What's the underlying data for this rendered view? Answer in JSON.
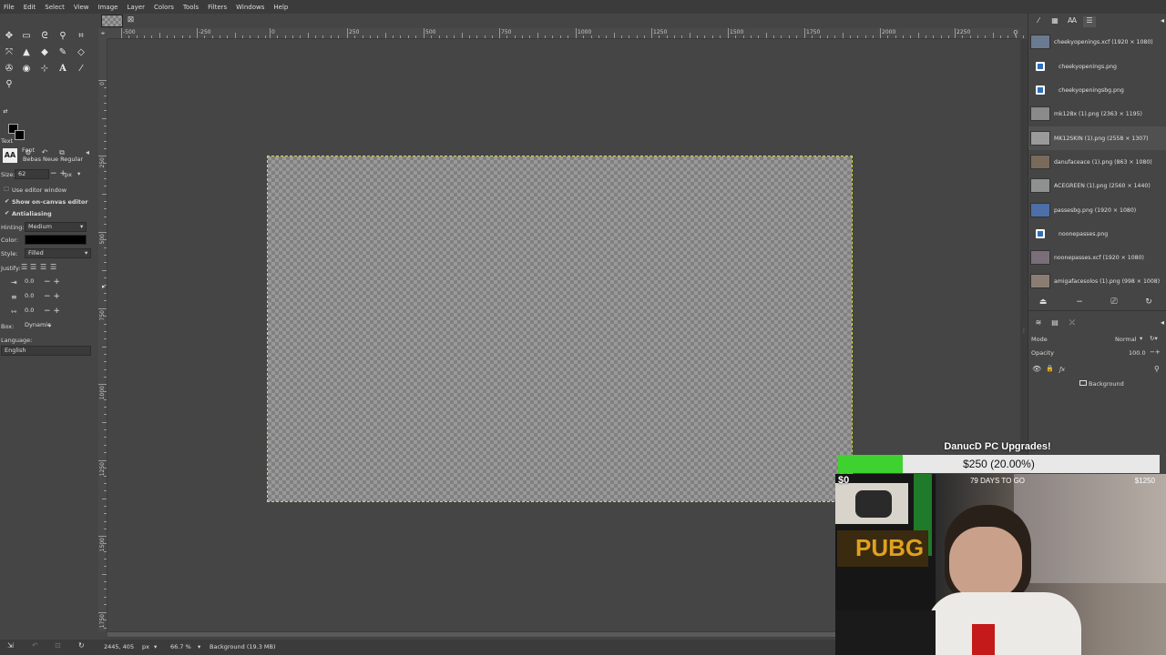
{
  "menu": [
    "File",
    "Edit",
    "Select",
    "View",
    "Image",
    "Layer",
    "Colors",
    "Tools",
    "Filters",
    "Windows",
    "Help"
  ],
  "tool_options": {
    "section": "Text",
    "font_label": "Font",
    "font_value": "Bebas Neue Regular",
    "size_label": "Size:",
    "size_value": "62",
    "size_unit": "px",
    "use_editor": "Use editor window",
    "show_on_canvas": "Show on-canvas editor",
    "antialiasing": "Antialiasing",
    "hinting_label": "Hinting:",
    "hinting_value": "Medium",
    "color_label": "Color:",
    "style_label": "Style:",
    "style_value": "Filled",
    "justify_label": "Justify:",
    "indent_value": "0.0",
    "line_spacing_value": "0.0",
    "letter_spacing_value": "0.0",
    "box_label": "Box:",
    "box_value": "Dynamic",
    "language_label": "Language:",
    "language_value": "English"
  },
  "ruler_labels": [
    "-500",
    "-250",
    "0",
    "250",
    "500",
    "750",
    "1000",
    "1250",
    "1500",
    "1750",
    "2000",
    "2250"
  ],
  "vruler_labels": [
    "0",
    "250",
    "500",
    "750",
    "1000",
    "1250",
    "1500",
    "1750"
  ],
  "images": [
    {
      "name": "cheekyopenings.xcf (1920 × 1080)",
      "thumb": "#6a7a90"
    },
    {
      "name": "cheekyopenings.png",
      "thumb": "icon"
    },
    {
      "name": "cheekyopeningsbg.png",
      "thumb": "icon"
    },
    {
      "name": "mk128x (1).png (2363 × 1195)",
      "thumb": "#8a8a8a"
    },
    {
      "name": "MK12SKIN (1).png (2558 × 1307)",
      "thumb": "#9a9a9a"
    },
    {
      "name": "danufaceace (1).png (863 × 1080)",
      "thumb": "#7a6a5a"
    },
    {
      "name": "ACEGREEN (1).png (2560 × 1440)",
      "thumb": "#8f9190"
    },
    {
      "name": "passesbg.png (1920 × 1080)",
      "thumb": "#4d6fa8"
    },
    {
      "name": "noonepasses.png",
      "thumb": "icon"
    },
    {
      "name": "noonepasses.xcf (1920 × 1080)",
      "thumb": "#7a6f78"
    },
    {
      "name": "amigafacesolos (1).png (998 × 1008)",
      "thumb": "#8a7e74"
    }
  ],
  "layers": {
    "mode_label": "Mode",
    "mode_value": "Normal",
    "opacity_label": "Opacity",
    "opacity_value": "100.0",
    "layer_name": "Background"
  },
  "status": {
    "coords": "2445, 405",
    "unit": "px",
    "zoom": "66.7 %",
    "info": "Background (19.3 MB)"
  },
  "donation_goal": {
    "title": "DanucD PC Upgrades!",
    "amount_text": "$250 (20.00%)",
    "progress": 0.2,
    "min_label": "$0",
    "days_label": "79 DAYS TO GO",
    "max_label": "$1250"
  },
  "colors": {
    "fill": "#3fd12f",
    "selection": "#d9d94a"
  }
}
